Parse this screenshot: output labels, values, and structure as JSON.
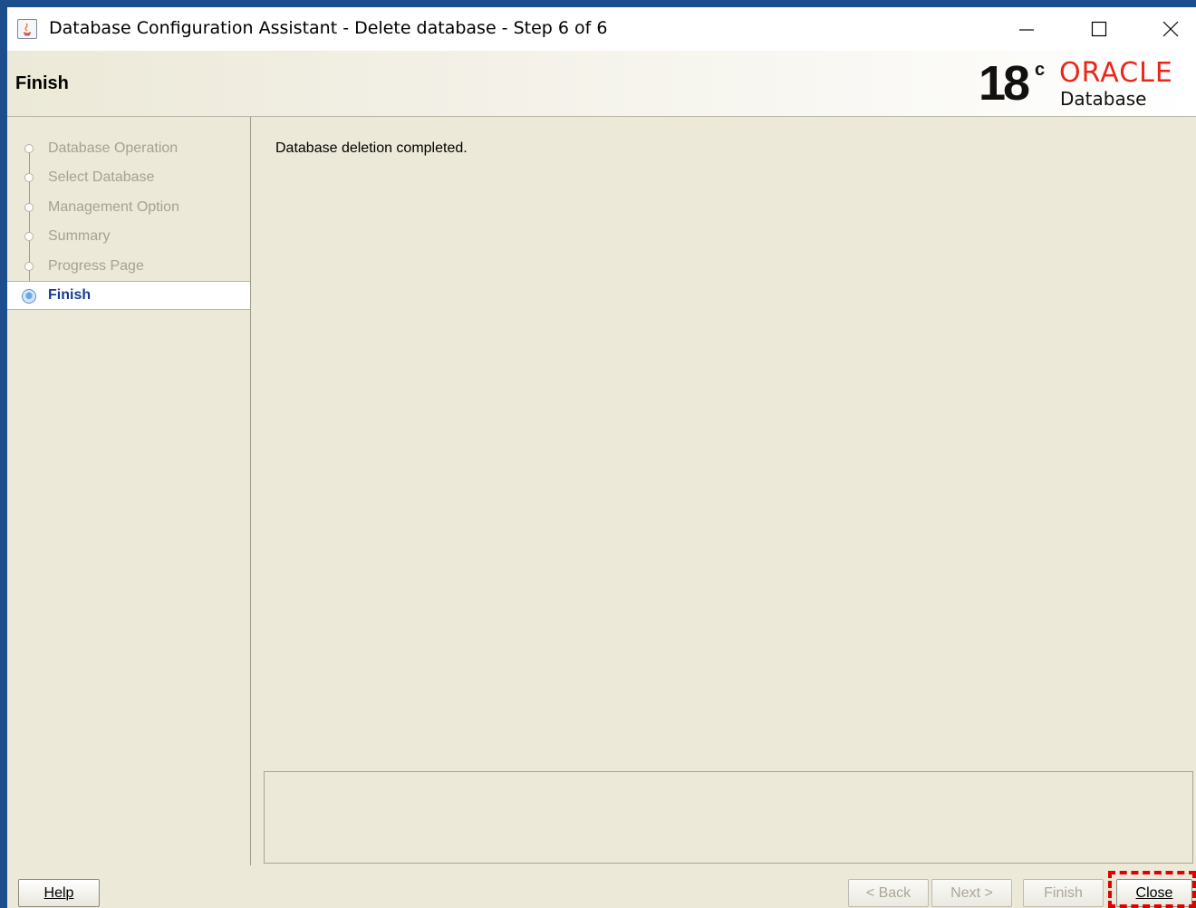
{
  "window": {
    "title": "Database Configuration Assistant - Delete database - Step 6 of 6"
  },
  "header": {
    "title": "Finish",
    "logo_version": "18",
    "logo_superscript": "c",
    "logo_brand": "ORACLE",
    "logo_product": "Database"
  },
  "steps": [
    {
      "label": "Database Operation",
      "state": "done"
    },
    {
      "label": "Select Database",
      "state": "done"
    },
    {
      "label": "Management Option",
      "state": "done"
    },
    {
      "label": "Summary",
      "state": "done"
    },
    {
      "label": "Progress Page",
      "state": "done"
    },
    {
      "label": "Finish",
      "state": "current"
    }
  ],
  "content": {
    "status_message": "Database deletion completed."
  },
  "buttons": {
    "help": "Help",
    "back": "< Back",
    "next": "Next >",
    "finish": "Finish",
    "close": "Close"
  },
  "colors": {
    "brand_red": "#e8261c",
    "active_step": "#1a3a8c",
    "highlight": "#e00000"
  }
}
